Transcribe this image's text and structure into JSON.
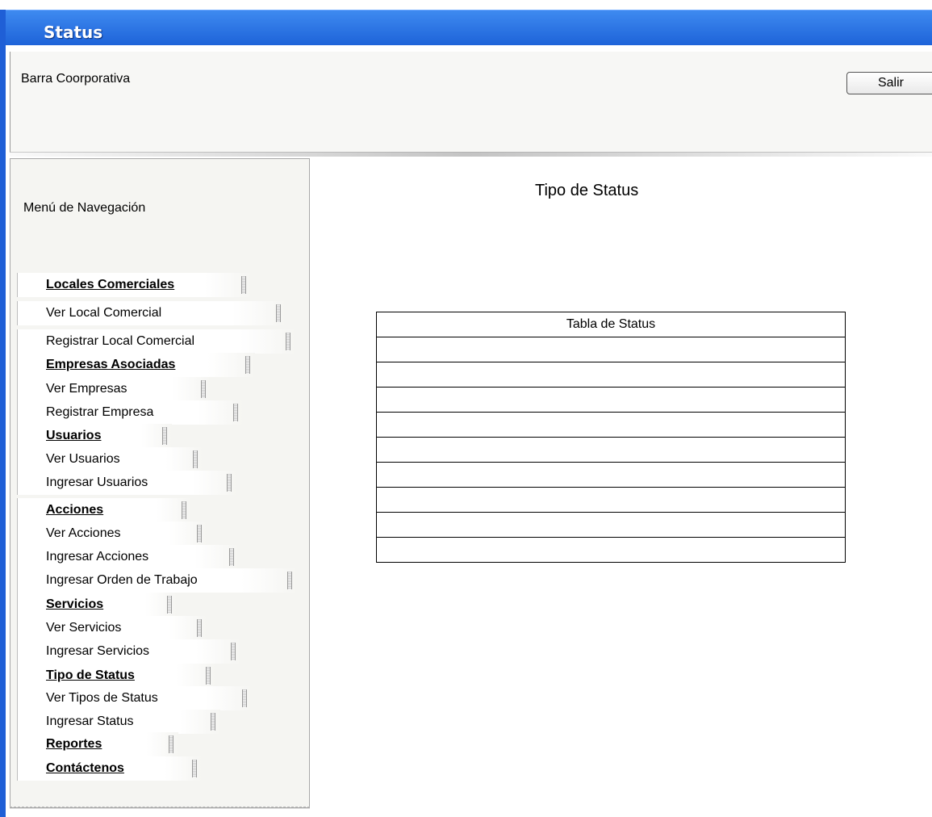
{
  "window": {
    "title": "Status"
  },
  "header": {
    "corporate_bar_label": "Barra Coorporativa",
    "exit_label": "Salir"
  },
  "nav": {
    "title": "Menú de Navegación",
    "items": [
      {
        "label": "Locales Comerciales",
        "section": true
      },
      {
        "label": "Ver Local Comercial",
        "section": false
      },
      {
        "label": "Registrar Local Comercial",
        "section": false
      },
      {
        "label": "Empresas Asociadas",
        "section": true
      },
      {
        "label": "Ver Empresas",
        "section": false
      },
      {
        "label": "Registrar Empresa",
        "section": false
      },
      {
        "label": "Usuarios",
        "section": true
      },
      {
        "label": "Ver Usuarios",
        "section": false
      },
      {
        "label": "Ingresar Usuarios",
        "section": false
      },
      {
        "label": "Acciones",
        "section": true
      },
      {
        "label": "Ver Acciones",
        "section": false
      },
      {
        "label": "Ingresar Acciones",
        "section": false
      },
      {
        "label": "Ingresar Orden de Trabajo",
        "section": false
      },
      {
        "label": "Servicios",
        "section": true
      },
      {
        "label": "Ver Servicios",
        "section": false
      },
      {
        "label": "Ingresar Servicios",
        "section": false
      },
      {
        "label": "Tipo de Status",
        "section": true
      },
      {
        "label": "Ver Tipos de Status",
        "section": false
      },
      {
        "label": "Ingresar Status",
        "section": false
      },
      {
        "label": "Reportes",
        "section": true
      },
      {
        "label": "Contáctenos",
        "section": true
      }
    ]
  },
  "main": {
    "title": "Tipo de Status",
    "table": {
      "header": "Tabla de Status",
      "rows": [
        "",
        "",
        "",
        "",
        "",
        "",
        "",
        "",
        ""
      ]
    }
  },
  "colors": {
    "title_bar": "#1d62d8",
    "panel_background": "#f5f5f2"
  }
}
